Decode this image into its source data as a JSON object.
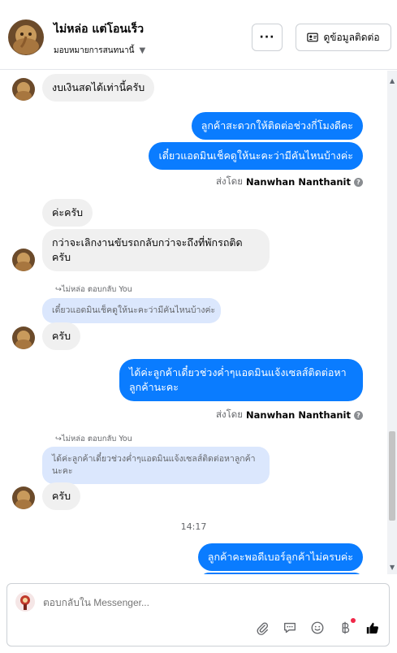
{
  "header": {
    "contact_name": "ไม่หล่อ แต่โอนเร็ว",
    "assign_label": "มอบหมายการสนทนานี้",
    "more_label": "···",
    "contact_info_label": "ดูข้อมูลติดต่อ"
  },
  "messages": {
    "m1": "งบเงินสดได้เท่านี้ครับ",
    "m2": "ลูกค้าสะดวกให้ติดต่อช่วงกี่โมงดีคะ",
    "m3": "เดี๋ยวแอดมินเช็คดูให้นะคะว่ามีคันไหนบ้างค่ะ",
    "sent_by_prefix": "ส่งโดย",
    "sent_by_name": "Nanwhan Nanthanit",
    "m4": "ค่ะครับ",
    "m5": "กว่าจะเลิกงานขับรถกลับกว่าจะถึงที่พักรถติดครับ",
    "replied_label_1": "ไม่หล่อ ตอบกลับ You",
    "quote_1": "เดี๋ยวแอดมินเช็คดูให้นะคะว่ามีคันไหนบ้างค่ะ",
    "m6": "ครับ",
    "m7": "ได้ค่ะลูกค้าเดี๋ยวช่วงค่ำๆแอดมินแจ้งเซลส์ติดต่อหาลูกค้านะคะ",
    "sent_by_prefix_2": "ส่งโดย",
    "sent_by_name_2": "Nanwhan Nanthanit",
    "replied_label_2": "ไม่หล่อ ตอบกลับ You",
    "quote_2": "ได้ค่ะลูกค้าเดี๋ยวช่วงค่ำๆแอดมินแจ้งเซลส์ติดต่อหาลูกค้านะคะ",
    "m8": "ครับ",
    "timestamp": "14:17",
    "m9": "ลูกค้าคะพอดีเบอร์ลูกค้าไม่ครบค่ะ"
  },
  "composer": {
    "placeholder": "ตอบกลับใน Messenger..."
  },
  "icons": {
    "attach": "paperclip-icon",
    "saved_reply": "chat-bubble-icon",
    "emoji": "smiley-icon",
    "payment": "baht-icon",
    "like": "thumbs-up-icon"
  },
  "colors": {
    "outgoing": "#0a7cff",
    "incoming": "#f0f0f0",
    "quote": "#dbe7fd",
    "accent_like": "#050505",
    "notification": "#f02849"
  }
}
